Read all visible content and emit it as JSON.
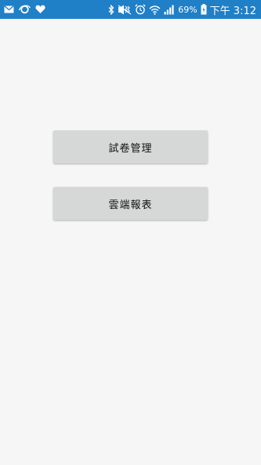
{
  "status_bar": {
    "icons_left": [
      "mail-icon",
      "sync-icon",
      "heart-icon"
    ],
    "icons_right": [
      "bluetooth-icon",
      "vibrate-mute-icon",
      "alarm-icon",
      "wifi-icon",
      "signal-icon",
      "battery-icon"
    ],
    "battery_percent": "69%",
    "time": "下午 3:12",
    "background_color": "#1f7fc7"
  },
  "main": {
    "buttons": [
      {
        "label": "試卷管理"
      },
      {
        "label": "雲端報表"
      }
    ],
    "button_color": "#d6d7d7",
    "background_color": "#f6f6f6"
  }
}
